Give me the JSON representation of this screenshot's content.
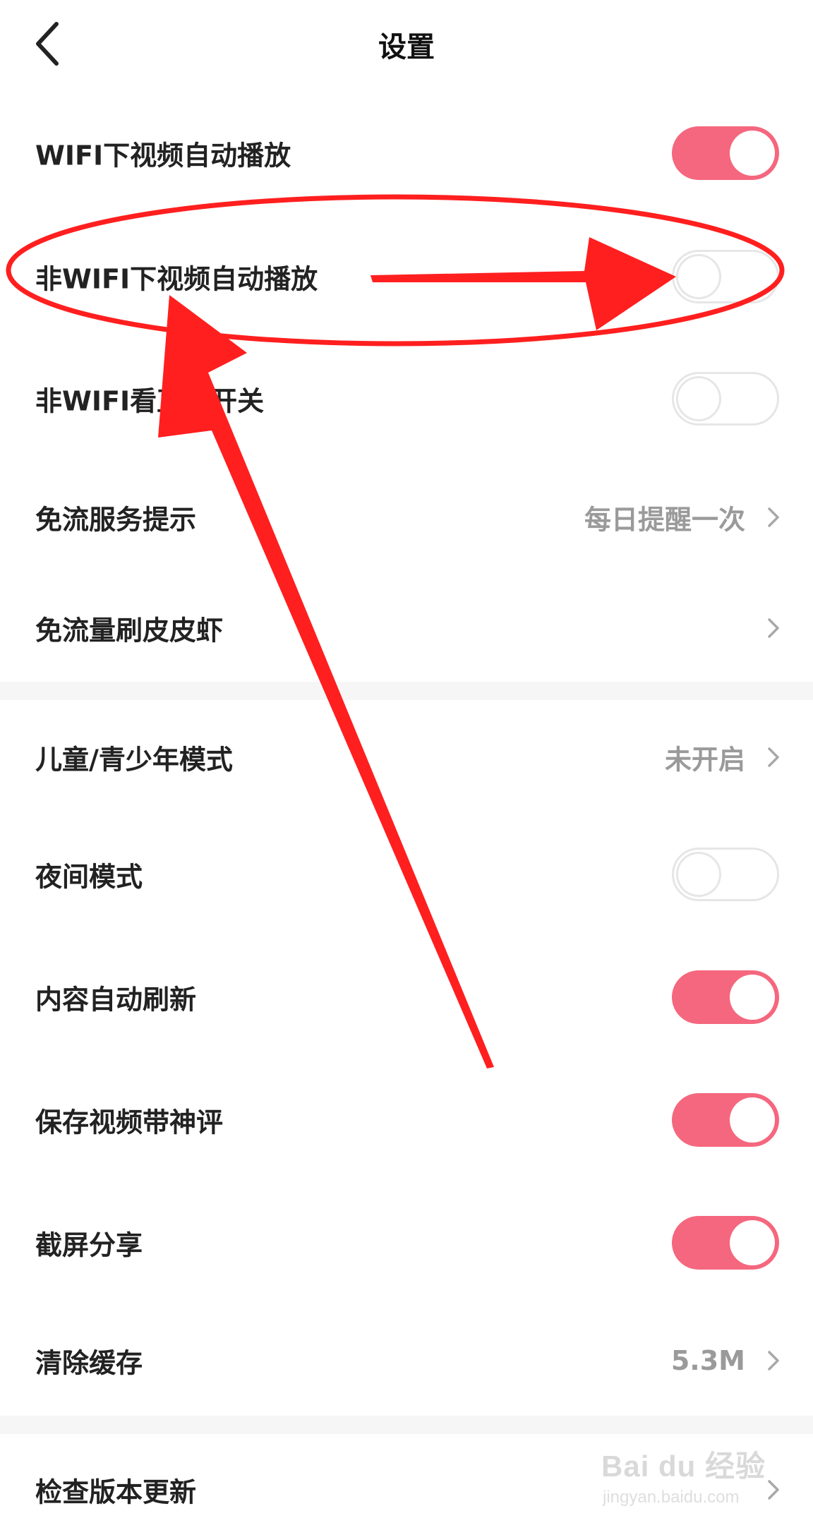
{
  "header": {
    "title": "设置"
  },
  "settings": {
    "wifi_autoplay": {
      "label": "WIFI下视频自动播放",
      "enabled": true
    },
    "non_wifi_autoplay": {
      "label": "非WIFI下视频自动播放",
      "enabled": false
    },
    "non_wifi_live": {
      "label": "非WIFI看直播开关",
      "enabled": false
    },
    "free_data_tip": {
      "label": "免流服务提示",
      "value": "每日提醒一次"
    },
    "free_data_app": {
      "label": "免流量刷皮皮虾"
    },
    "youth_mode": {
      "label": "儿童/青少年模式",
      "value": "未开启"
    },
    "night_mode": {
      "label": "夜间模式",
      "enabled": false
    },
    "auto_refresh": {
      "label": "内容自动刷新",
      "enabled": true
    },
    "save_with_comment": {
      "label": "保存视频带神评",
      "enabled": true
    },
    "screenshot_share": {
      "label": "截屏分享",
      "enabled": true
    },
    "clear_cache": {
      "label": "清除缓存",
      "value": "5.3M"
    },
    "check_update": {
      "label": "检查版本更新"
    }
  },
  "colors": {
    "toggle_on": "#f5677e",
    "toggle_off_border": "#e6e6e6",
    "annotation_red": "#ff1f1f"
  },
  "watermark": {
    "brand": "Bai du 经验",
    "url": "jingyan.baidu.com"
  },
  "icons": {
    "back": "chevron-left-icon",
    "row_arrow": "chevron-right-icon"
  }
}
